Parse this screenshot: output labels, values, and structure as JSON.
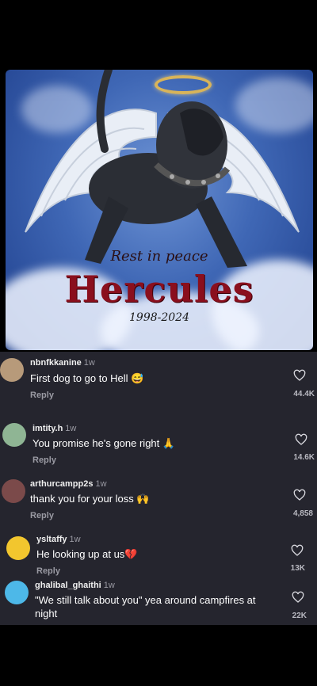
{
  "post": {
    "rip_line": "Rest in peace",
    "title": "Hercules",
    "years": "1998-2024"
  },
  "comments": [
    {
      "username": "nbnfkkanine",
      "time": "1w",
      "text": "First dog to go to Hell",
      "emoji": "😅",
      "reply": "Reply",
      "likes": "44.4K"
    },
    {
      "username": "imtity.h",
      "time": "1w",
      "text": "You promise he's gone right",
      "emoji": "🙏",
      "reply": "Reply",
      "likes": "14.6K"
    },
    {
      "username": "arthurcampp2s",
      "time": "1w",
      "text": "thank you for your loss",
      "emoji": "🙌",
      "reply": "Reply",
      "likes": "4,858"
    },
    {
      "username": "ysltaffy",
      "time": "1w",
      "text": "He looking up at us",
      "emoji": "💔",
      "reply": "Reply",
      "likes": "13K"
    },
    {
      "username": "ghalibal_ghaithi",
      "time": "1w",
      "text": "\"We still talk about you\" yea around campfires at night",
      "emoji": "",
      "reply": "",
      "likes": "22K"
    }
  ],
  "colors": {
    "panel": "#25252e",
    "title": "#8a0f1d",
    "halo": "#d8b45a"
  },
  "icons": {
    "like": "heart-outline-icon"
  }
}
